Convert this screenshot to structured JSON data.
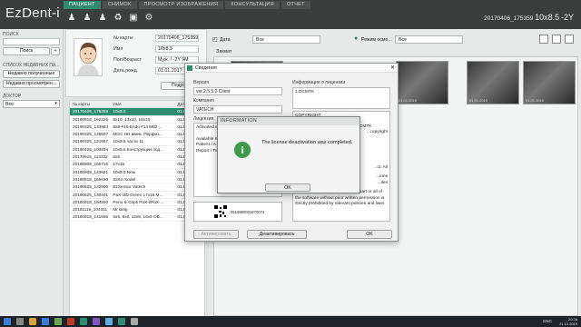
{
  "app": {
    "logo": "EzDent-i",
    "tabs": [
      "ПАЦИЕНТ",
      "СНИМОК",
      "ПРОСМОТР ИЗОБРАЖЕНИЯ",
      "КОНСУЛЬТАЦИЯ",
      "ОТЧЕТ"
    ],
    "active_tab": 0,
    "patient_title": {
      "id": "20170406_175359",
      "name": "10x8.5",
      "age": "-2Y"
    }
  },
  "left_panel": {
    "search_label": "ПОИСК",
    "search_button": "Поиск",
    "plus_button": "+",
    "recent_label": "СПИСОК НЕДАВНИХ ПА...",
    "recent_received": "Недавно полученные",
    "recent_viewed": "Недавно просмотрен...",
    "doctor_label": "ДОКТОР",
    "doctor_value": "Все"
  },
  "patient_info": {
    "rows": [
      {
        "label": "№ карты",
        "value": "20170406_175359"
      },
      {
        "label": "Имя",
        "value": "10x8.5"
      },
      {
        "label": "Пол/Возраст",
        "value": "Муж. / -2Y 9M"
      },
      {
        "label": "Дата.рожд.",
        "value": "01.01.2017"
      }
    ],
    "details_button": "Подробно"
  },
  "patient_table": {
    "headers": [
      "№ карты",
      "Имя",
      "Дата..."
    ],
    "rows": [
      [
        "20170406_175359",
        "10x8.5",
        "01.01."
      ],
      [
        "20180918_162226",
        "8x10, 13x10, 18x10",
        "01.01."
      ],
      [
        "20190325_133923",
        "8x8-#16-Endo #14 M82 ...",
        "01.01."
      ],
      [
        "20190325_145507",
        "МОС НН имев. Перфоз...",
        "01.01."
      ],
      [
        "20190325_121957",
        "10x8.5 части 11",
        "01.01."
      ],
      [
        "20180426_100834",
        "10x8.5 Конструкции под...",
        "01.01."
      ],
      [
        "20170915_113322",
        "5x5",
        "01.01."
      ],
      [
        "20180908_165716",
        "17x15",
        "01.01."
      ],
      [
        "20180908_143621",
        "10x8.5 New",
        "01.01."
      ],
      [
        "20180918_165630",
        "Sinte model",
        "01.01."
      ],
      [
        "20190625_122900",
        "EzSensor Vatech",
        "01.01."
      ],
      [
        "20190625_130401",
        "PaX-i3D Green 17x15 M...",
        "01.01."
      ],
      [
        "20180918_164920",
        "Perio & Cepti PaX-i/PaX-...",
        "01.01."
      ],
      [
        "20181119_104311",
        "Mr Belg",
        "01.01."
      ],
      [
        "20180918_141555",
        "5x5, 8x8, 12x8, 16x9 OB...",
        "01.01."
      ]
    ],
    "selected_index": 0
  },
  "right_area": {
    "date_label": "Дата",
    "date_filter": "Все",
    "mode_label": "Режим осмо...",
    "mode_filter": "Все",
    "gallery_title": "Захват",
    "thumbs": [
      "01.01.2019",
      "01.01.2019",
      "01.01.2019",
      "01.01.2019"
    ]
  },
  "about_dialog": {
    "title": "Сведения",
    "version_label": "Версия",
    "version_value": "ver.2.5.5.0 Client",
    "company_label": "Компания",
    "company_value": "VATECH",
    "license_label": "Лицензия",
    "license_lines": [
      "Activated w...",
      "",
      "Available m...",
      "Patient / A...",
      "Report / Tw..."
    ],
    "product_info_label": "Информация о лицензии",
    "product_info_value": "1.DCMTK",
    "copyright_lines": [
      "COPYRIGHT",
      "",
      "Unless otherwise specified, the DCMTK",
      "...copyright"
    ],
    "license_text_tail": [
      "...ct. All",
      "",
      "...ions",
      "...iles"
    ],
    "license_text_bottom": "The act of copying or distributing part or all of the software without prior written permission is strictly prohibited by relevant policies and laws",
    "serial": "0510880001970074",
    "activate_button": "Активировать",
    "deactivate_button": "Деактивировать",
    "ok_button": "OK"
  },
  "info_popup": {
    "title": "INFORMATION",
    "message": "The license deactivation was completed.",
    "ok_button": "OK",
    "icon": "info-icon"
  },
  "taskbar": {
    "lang": "ENG",
    "time": "20:28",
    "date": "21.10.2019"
  },
  "colors": {
    "accent": "#2e8c6f",
    "header": "#3a3f3d",
    "info_green": "#3c9a4a"
  }
}
